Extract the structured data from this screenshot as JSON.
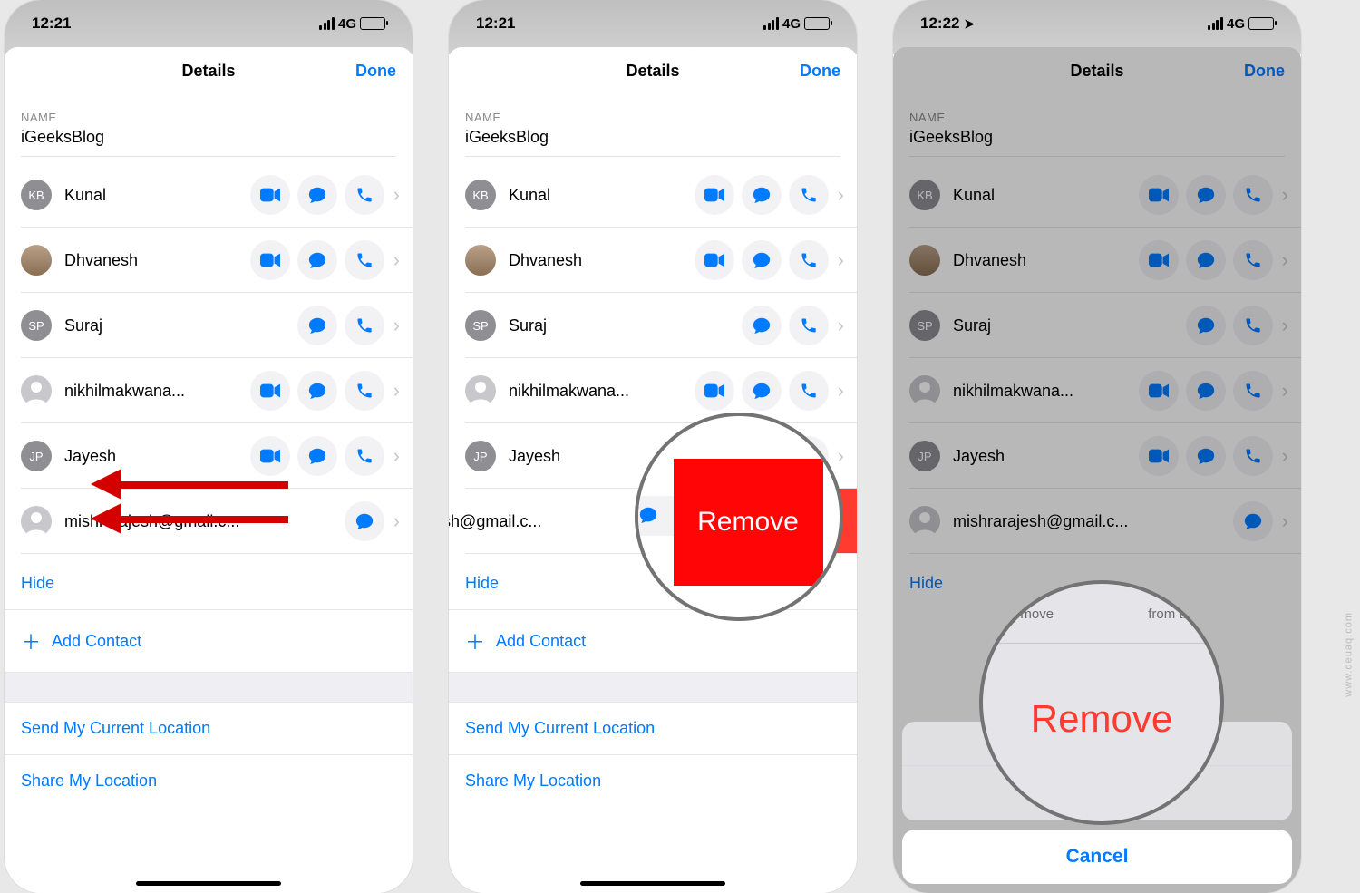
{
  "statusbar": {
    "time1": "12:21",
    "time2": "12:21",
    "time3": "12:22",
    "network": "4G"
  },
  "sheet": {
    "title": "Details",
    "done": "Done",
    "name_label": "NAME",
    "name_value": "iGeeksBlog",
    "hide": "Hide",
    "add_contact": "Add Contact",
    "send_location": "Send My Current Location",
    "share_location": "Share My Location"
  },
  "contacts": [
    {
      "name": "Kunal",
      "initials": "KB",
      "avatar": "gray",
      "video": true,
      "msg": true,
      "call": true
    },
    {
      "name": "Dhvanesh",
      "initials": "",
      "avatar": "photo",
      "video": true,
      "msg": true,
      "call": true
    },
    {
      "name": "Suraj",
      "initials": "SP",
      "avatar": "gray",
      "video": false,
      "msg": true,
      "call": true
    },
    {
      "name": "nikhilmakwana...",
      "initials": "",
      "avatar": "silhouette",
      "video": true,
      "msg": true,
      "call": true
    },
    {
      "name": "Jayesh",
      "initials": "JP",
      "avatar": "gray",
      "video": true,
      "msg": true,
      "call": true
    },
    {
      "name": "mishrarajesh@gmail.c...",
      "initials": "",
      "avatar": "silhouette",
      "video": false,
      "msg": true,
      "call": false
    }
  ],
  "swipe": {
    "remove_label": "Remove",
    "swiped_name": "shrarajesh@gmail.c..."
  },
  "actionsheet": {
    "msg_left": "Remove",
    "msg_right": "from this",
    "remove": "Remove",
    "cancel": "Cancel"
  },
  "watermark": "www.deuaq.com"
}
